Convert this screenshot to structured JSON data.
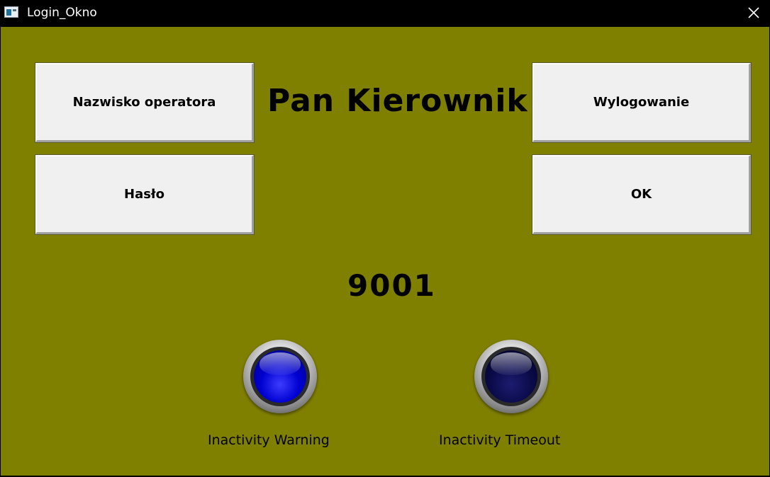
{
  "window": {
    "title": "Login_Okno",
    "icon": "app-window-icon",
    "close_icon": "close-icon"
  },
  "colors": {
    "background": "#808000",
    "button_face": "#f0f0f0",
    "lamp_warning": "#0000d0",
    "lamp_timeout": "#0a0a48"
  },
  "buttons": {
    "operator_name": "Nazwisko operatora",
    "password": "Hasło",
    "logout": "Wylogowanie",
    "ok": "OK"
  },
  "display": {
    "operator_name": "Pan Kierownik",
    "code": "9001"
  },
  "indicators": [
    {
      "label": "Inactivity Warning",
      "state": "on"
    },
    {
      "label": "Inactivity Timeout",
      "state": "off"
    }
  ]
}
